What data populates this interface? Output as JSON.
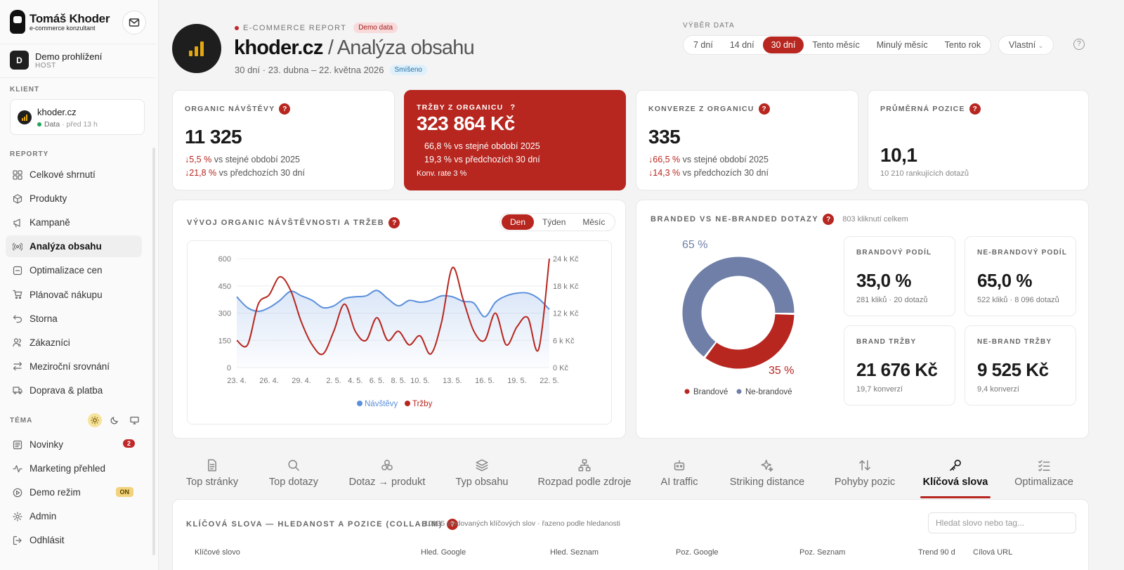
{
  "brand": {
    "name": "Tomáš Khoder",
    "tagline": "e-commerce konzultant"
  },
  "account": {
    "initial": "D",
    "name": "Demo prohlížení",
    "role": "HOST"
  },
  "sidebar": {
    "client_label": "KLIENT",
    "client": {
      "name": "khoder.cz",
      "status": "Data",
      "updated": "· před 13 h"
    },
    "reports_label": "REPORTY",
    "items": [
      {
        "label": "Celkové shrnutí",
        "icon": "grid-icon"
      },
      {
        "label": "Produkty",
        "icon": "box-icon"
      },
      {
        "label": "Kampaně",
        "icon": "megaphone-icon"
      },
      {
        "label": "Analýza obsahu",
        "icon": "broadcast-icon",
        "active": true
      },
      {
        "label": "Optimalizace cen",
        "icon": "tag-icon"
      },
      {
        "label": "Plánovač nákupu",
        "icon": "cart-icon"
      },
      {
        "label": "Storna",
        "icon": "undo-icon"
      },
      {
        "label": "Zákazníci",
        "icon": "users-icon"
      },
      {
        "label": "Meziroční srovnání",
        "icon": "swap-icon"
      },
      {
        "label": "Doprava & platba",
        "icon": "truck-icon"
      }
    ],
    "theme_label": "TÉMA",
    "bottom": [
      {
        "label": "Novinky",
        "icon": "news-icon",
        "badge": "2"
      },
      {
        "label": "Marketing přehled",
        "icon": "activity-icon"
      },
      {
        "label": "Demo režim",
        "icon": "play-icon",
        "badge": "ON"
      },
      {
        "label": "Admin",
        "icon": "gear-icon"
      },
      {
        "label": "Odhlásit",
        "icon": "logout-icon"
      }
    ]
  },
  "header": {
    "eyebrow": "E-COMMERCE REPORT",
    "demo_tag": "Demo data",
    "title_main": "khoder.cz",
    "title_sub": " / Analýza obsahu",
    "subtitle": "30 dní · 23. dubna – 22. května 2026",
    "mix_tag": "Smíšeno",
    "date_label": "VÝBĚR DATA",
    "date_tabs": [
      "7 dní",
      "14 dní",
      "30 dní",
      "Tento měsíc",
      "Minulý měsíc",
      "Tento rok"
    ],
    "custom": "Vlastní"
  },
  "kpis": [
    {
      "label": "ORGANIC NÁVŠTĚVY",
      "value": "11 325",
      "l1": "↓5,5 %",
      "l1t": " vs stejné období 2025",
      "l2": "↓21,8 %",
      "l2t": " vs předchozích 30 dní"
    },
    {
      "label": "TRŽBY Z ORGANICU",
      "value": "323 864 Kč",
      "l1": "66,8 %",
      "l1t": " vs stejné období 2025",
      "l2": "19,3 %",
      "l2t": " vs předchozích 30 dní",
      "note": "Konv. rate 3 %"
    },
    {
      "label": "KONVERZE Z ORGANICU",
      "value": "335",
      "l1": "↓66,5 %",
      "l1t": " vs stejné období 2025",
      "l2": "↓14,3 %",
      "l2t": " vs předchozích 30 dní"
    },
    {
      "label": "PRŮMĚRNÁ POZICE",
      "value": "10,1",
      "note": "10 210 rankujících dotazů"
    }
  ],
  "trend": {
    "title": "VÝVOJ ORGANIC NÁVŠTĚVNOSTI A TRŽEB",
    "granularity": [
      "Den",
      "Týden",
      "Měsíc"
    ],
    "legend": [
      "Návštěvy",
      "Tržby"
    ]
  },
  "chart_data": {
    "type": "line",
    "x": [
      "23. 4.",
      "24. 4.",
      "25. 4.",
      "26. 4.",
      "27. 4.",
      "28. 4.",
      "29. 4.",
      "30. 4.",
      "1. 5.",
      "2. 5.",
      "3. 5.",
      "4. 5.",
      "5. 5.",
      "6. 5.",
      "7. 5.",
      "8. 5.",
      "9. 5.",
      "10. 5.",
      "11. 5.",
      "12. 5.",
      "13. 5.",
      "14. 5.",
      "15. 5.",
      "16. 5.",
      "17. 5.",
      "18. 5.",
      "19. 5.",
      "20. 5.",
      "21. 5.",
      "22. 5."
    ],
    "x_ticks": [
      "23. 4.",
      "26. 4.",
      "29. 4.",
      "2. 5.",
      "4. 5.",
      "6. 5.",
      "8. 5.",
      "10. 5.",
      "13. 5.",
      "16. 5.",
      "19. 5.",
      "22. 5."
    ],
    "series": [
      {
        "name": "Návštěvy",
        "axis": "left",
        "color": "#5b8fdc",
        "values": [
          390,
          330,
          310,
          330,
          370,
          420,
          395,
          370,
          330,
          340,
          380,
          390,
          395,
          425,
          380,
          340,
          370,
          360,
          370,
          395,
          390,
          365,
          355,
          280,
          360,
          395,
          410,
          410,
          380,
          320
        ]
      },
      {
        "name": "Tržby",
        "axis": "right",
        "color": "#b7261f",
        "values": [
          6,
          5,
          14,
          16,
          20,
          17,
          10,
          5,
          3,
          8,
          14,
          8,
          6,
          11,
          6,
          8,
          5,
          7,
          3,
          10,
          22,
          15,
          8,
          6,
          12,
          5,
          9,
          11,
          4,
          24
        ]
      }
    ],
    "ylim_left": [
      0,
      600
    ],
    "yticks_left": [
      "0",
      "150",
      "300",
      "450",
      "600"
    ],
    "ylim_right": [
      0,
      24
    ],
    "yticks_right": [
      "0 Kč",
      "6 k Kč",
      "12 k Kč",
      "18 k Kč",
      "24 k Kč"
    ],
    "grid": true,
    "legend": "bottom-center"
  },
  "branded": {
    "title": "BRANDED VS NE-BRANDED DOTAZY",
    "total": "803 kliknutí celkem",
    "donut": {
      "branded_pct": 35,
      "nonbranded_pct": 65,
      "label_nb": "65 %",
      "label_b": "35 %",
      "color_b": "#b7261f",
      "color_nb": "#6f7fa8"
    },
    "legend": [
      "Brandové",
      "Ne-brandové"
    ],
    "minis": [
      {
        "label": "BRANDOVÝ PODÍL",
        "value": "35,0 %",
        "sub": "281 kliků · 20 dotazů"
      },
      {
        "label": "NE-BRANDOVÝ PODÍL",
        "value": "65,0 %",
        "sub": "522 kliků · 8 096 dotazů"
      },
      {
        "label": "BRAND TRŽBY",
        "value": "21 676 Kč",
        "sub": "19,7 konverzí"
      },
      {
        "label": "NE-BRAND TRŽBY",
        "value": "9 525 Kč",
        "sub": "9,4 konverzí"
      }
    ]
  },
  "tabs": [
    {
      "label": "Top stránky",
      "icon": "file-icon"
    },
    {
      "label": "Top dotazy",
      "icon": "search-icon"
    },
    {
      "label": "Dotaz → produkt",
      "icon": "boxes-icon"
    },
    {
      "label": "Typ obsahu",
      "icon": "layers-icon"
    },
    {
      "label": "Rozpad podle zdroje",
      "icon": "network-icon"
    },
    {
      "label": "AI traffic",
      "icon": "bot-icon"
    },
    {
      "label": "Striking distance",
      "icon": "sparkle-icon"
    },
    {
      "label": "Pohyby pozic",
      "icon": "arrows-updown-icon"
    },
    {
      "label": "Klíčová slova",
      "icon": "key-icon",
      "active": true
    },
    {
      "label": "Optimalizace",
      "icon": "checklist-icon"
    }
  ],
  "keywords": {
    "title": "KLÍČOVÁ SLOVA — HLEDANOST A POZICE (COLLABIM)",
    "sub": "10135 sledovaných klíčových slov · řazeno podle hledanosti",
    "search_placeholder": "Hledat slovo nebo tag...",
    "columns": [
      "Klíčové slovo",
      "Hled. Google",
      "Hled. Seznam",
      "Poz. Google",
      "Poz. Seznam",
      "Trend 90 d",
      "Cílová URL"
    ]
  }
}
